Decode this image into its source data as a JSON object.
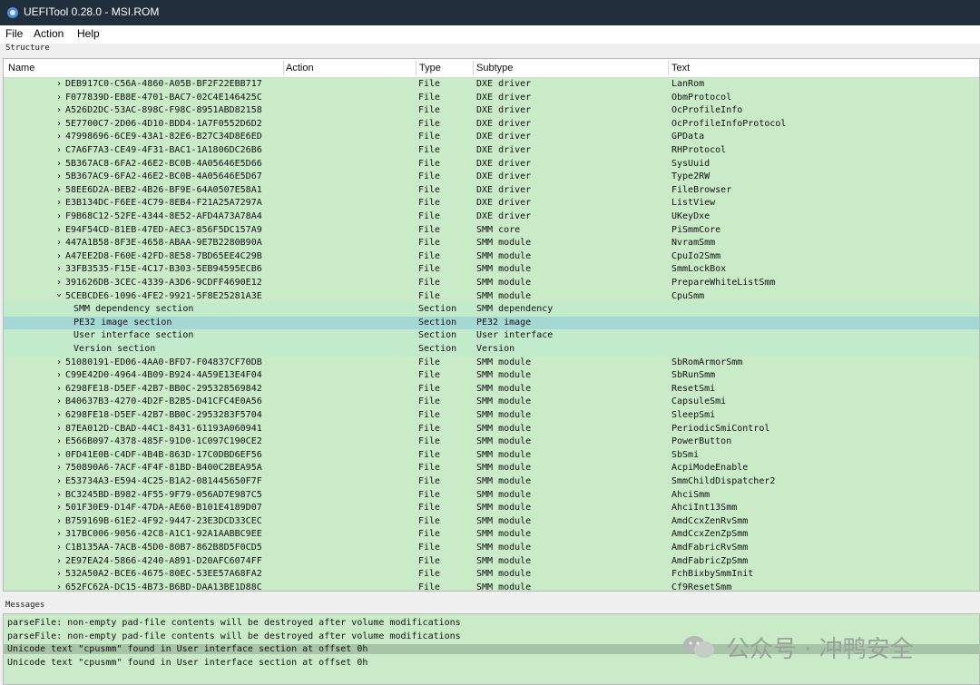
{
  "window": {
    "title": "UEFITool 0.28.0 - MSI.ROM"
  },
  "menu": [
    "File",
    "Action",
    "Help"
  ],
  "structure_label": "Structure",
  "columns": [
    "Name",
    "Action",
    "Type",
    "Subtype",
    "Text"
  ],
  "rows": [
    {
      "name": "DEB917C0-C56A-4860-A05B-BF2F22EBB717",
      "type": "File",
      "subtype": "DXE driver",
      "text": "LanRom"
    },
    {
      "name": "F077839D-EB8E-4701-BAC7-02C4E146425C",
      "type": "File",
      "subtype": "DXE driver",
      "text": "ObmProtocol"
    },
    {
      "name": "A526D2DC-53AC-898C-F98C-8951ABD82158",
      "type": "File",
      "subtype": "DXE driver",
      "text": "OcProfileInfo"
    },
    {
      "name": "5E7700C7-2D06-4D10-BDD4-1A7F0552D6D2",
      "type": "File",
      "subtype": "DXE driver",
      "text": "OcProfileInfoProtocol"
    },
    {
      "name": "47998696-6CE9-43A1-82E6-B27C34D8E6ED",
      "type": "File",
      "subtype": "DXE driver",
      "text": "GPData"
    },
    {
      "name": "C7A6F7A3-CE49-4F31-BAC1-1A1806DC26B6",
      "type": "File",
      "subtype": "DXE driver",
      "text": "RHProtocol"
    },
    {
      "name": "5B367AC8-6FA2-46E2-BC0B-4A05646E5D66",
      "type": "File",
      "subtype": "DXE driver",
      "text": "SysUuid"
    },
    {
      "name": "5B367AC9-6FA2-46E2-BC0B-4A05646E5D67",
      "type": "File",
      "subtype": "DXE driver",
      "text": "Type2RW"
    },
    {
      "name": "58EE6D2A-BEB2-4B26-BF9E-64A0507E58A1",
      "type": "File",
      "subtype": "DXE driver",
      "text": "FileBrowser"
    },
    {
      "name": "E3B134DC-F6EE-4C79-8EB4-F21A25A7297A",
      "type": "File",
      "subtype": "DXE driver",
      "text": "ListView"
    },
    {
      "name": "F9B68C12-52FE-4344-8E52-AFD4A73A78A4",
      "type": "File",
      "subtype": "DXE driver",
      "text": "UKeyDxe"
    },
    {
      "name": "E94F54CD-81EB-47ED-AEC3-856F5DC157A9",
      "type": "File",
      "subtype": "SMM core",
      "text": "PiSmmCore"
    },
    {
      "name": "447A1B58-8F3E-4658-ABAA-9E7B2280B90A",
      "type": "File",
      "subtype": "SMM module",
      "text": "NvramSmm"
    },
    {
      "name": "A47EE2D8-F60E-42FD-8E58-7BD65EE4C29B",
      "type": "File",
      "subtype": "SMM module",
      "text": "CpuIo2Smm"
    },
    {
      "name": "33FB3535-F15E-4C17-B303-5EB94595ECB6",
      "type": "File",
      "subtype": "SMM module",
      "text": "SmmLockBox"
    },
    {
      "name": "391626DB-3CEC-4339-A3D6-9CDFF4690E12",
      "type": "File",
      "subtype": "SMM module",
      "text": "PrepareWhiteListSmm"
    },
    {
      "name": "5CEBCDE6-1096-4FE2-9921-5F8E25281A3E",
      "type": "File",
      "subtype": "SMM module",
      "text": "CpuSmm",
      "expanded": true
    },
    {
      "name": "SMM dependency section",
      "type": "Section",
      "subtype": "SMM dependency",
      "text": "",
      "child": true
    },
    {
      "name": "PE32 image section",
      "type": "Section",
      "subtype": "PE32 image",
      "text": "",
      "child": true,
      "selected": true
    },
    {
      "name": "User interface section",
      "type": "Section",
      "subtype": "User interface",
      "text": "",
      "child": true
    },
    {
      "name": "Version section",
      "type": "Section",
      "subtype": "Version",
      "text": "",
      "child": true
    },
    {
      "name": "51080191-ED06-4AA0-BFD7-F04837CF70DB",
      "type": "File",
      "subtype": "SMM module",
      "text": "SbRomArmorSmm"
    },
    {
      "name": "C99E42D0-4964-4B09-B924-4A59E13E4F04",
      "type": "File",
      "subtype": "SMM module",
      "text": "SbRunSmm"
    },
    {
      "name": "6298FE18-D5EF-42B7-BB0C-295328569842",
      "type": "File",
      "subtype": "SMM module",
      "text": "ResetSmi"
    },
    {
      "name": "B40637B3-4270-4D2F-B2B5-D41CFC4E0A56",
      "type": "File",
      "subtype": "SMM module",
      "text": "CapsuleSmi"
    },
    {
      "name": "6298FE18-D5EF-42B7-BB0C-2953283F5704",
      "type": "File",
      "subtype": "SMM module",
      "text": "SleepSmi"
    },
    {
      "name": "87EA012D-CBAD-44C1-8431-61193A060941",
      "type": "File",
      "subtype": "SMM module",
      "text": "PeriodicSmiControl"
    },
    {
      "name": "E566B097-4378-485F-91D0-1C097C190CE2",
      "type": "File",
      "subtype": "SMM module",
      "text": "PowerButton"
    },
    {
      "name": "0FD41E0B-C4DF-4B4B-863D-17C0DBD6EF56",
      "type": "File",
      "subtype": "SMM module",
      "text": "SbSmi"
    },
    {
      "name": "750890A6-7ACF-4F4F-81BD-B400C2BEA95A",
      "type": "File",
      "subtype": "SMM module",
      "text": "AcpiModeEnable"
    },
    {
      "name": "E53734A3-E594-4C25-B1A2-081445650F7F",
      "type": "File",
      "subtype": "SMM module",
      "text": "SmmChildDispatcher2"
    },
    {
      "name": "BC3245BD-B982-4F55-9F79-056AD7E987C5",
      "type": "File",
      "subtype": "SMM module",
      "text": "AhciSmm"
    },
    {
      "name": "501F30E9-D14F-47DA-AE60-B101E4189D07",
      "type": "File",
      "subtype": "SMM module",
      "text": "AhciInt13Smm"
    },
    {
      "name": "B759169B-61E2-4F92-9447-23E3DCD33CEC",
      "type": "File",
      "subtype": "SMM module",
      "text": "AmdCcxZenRvSmm"
    },
    {
      "name": "317BC006-9056-42C8-A1C1-92A1AABBC9EE",
      "type": "File",
      "subtype": "SMM module",
      "text": "AmdCcxZenZpSmm"
    },
    {
      "name": "C1B135AA-7ACB-45D0-80B7-862B8D5F0CD5",
      "type": "File",
      "subtype": "SMM module",
      "text": "AmdFabricRvSmm"
    },
    {
      "name": "2E97EA24-5866-4240-A891-D20AFC6074FF",
      "type": "File",
      "subtype": "SMM module",
      "text": "AmdFabricZpSmm"
    },
    {
      "name": "532A50A2-BCE6-4675-80EC-53EE57A68FA2",
      "type": "File",
      "subtype": "SMM module",
      "text": "FchBixbySmmInit"
    },
    {
      "name": "652FC62A-DC15-4B73-B6BD-DAA13BE1D88C",
      "type": "File",
      "subtype": "SMM module",
      "text": "Cf9ResetSmm"
    }
  ],
  "messages_label": "Messages",
  "messages": [
    {
      "text": "parseFile: non-empty pad-file contents will be destroyed after volume modifications"
    },
    {
      "text": "parseFile: non-empty pad-file contents will be destroyed after volume modifications"
    },
    {
      "text": "Unicode text \"cpusmm\" found in User interface section at offset 0h",
      "highlight": true
    },
    {
      "text": "Unicode text \"cpusmm\" found in User interface section at offset 0h"
    }
  ],
  "watermark": "公众号 · 冲鸭安全",
  "icons": {
    "expand": "chevron-right-icon",
    "collapse": "chevron-down-icon",
    "app": "uefitool-app-icon",
    "watermark": "wechat-icon"
  }
}
